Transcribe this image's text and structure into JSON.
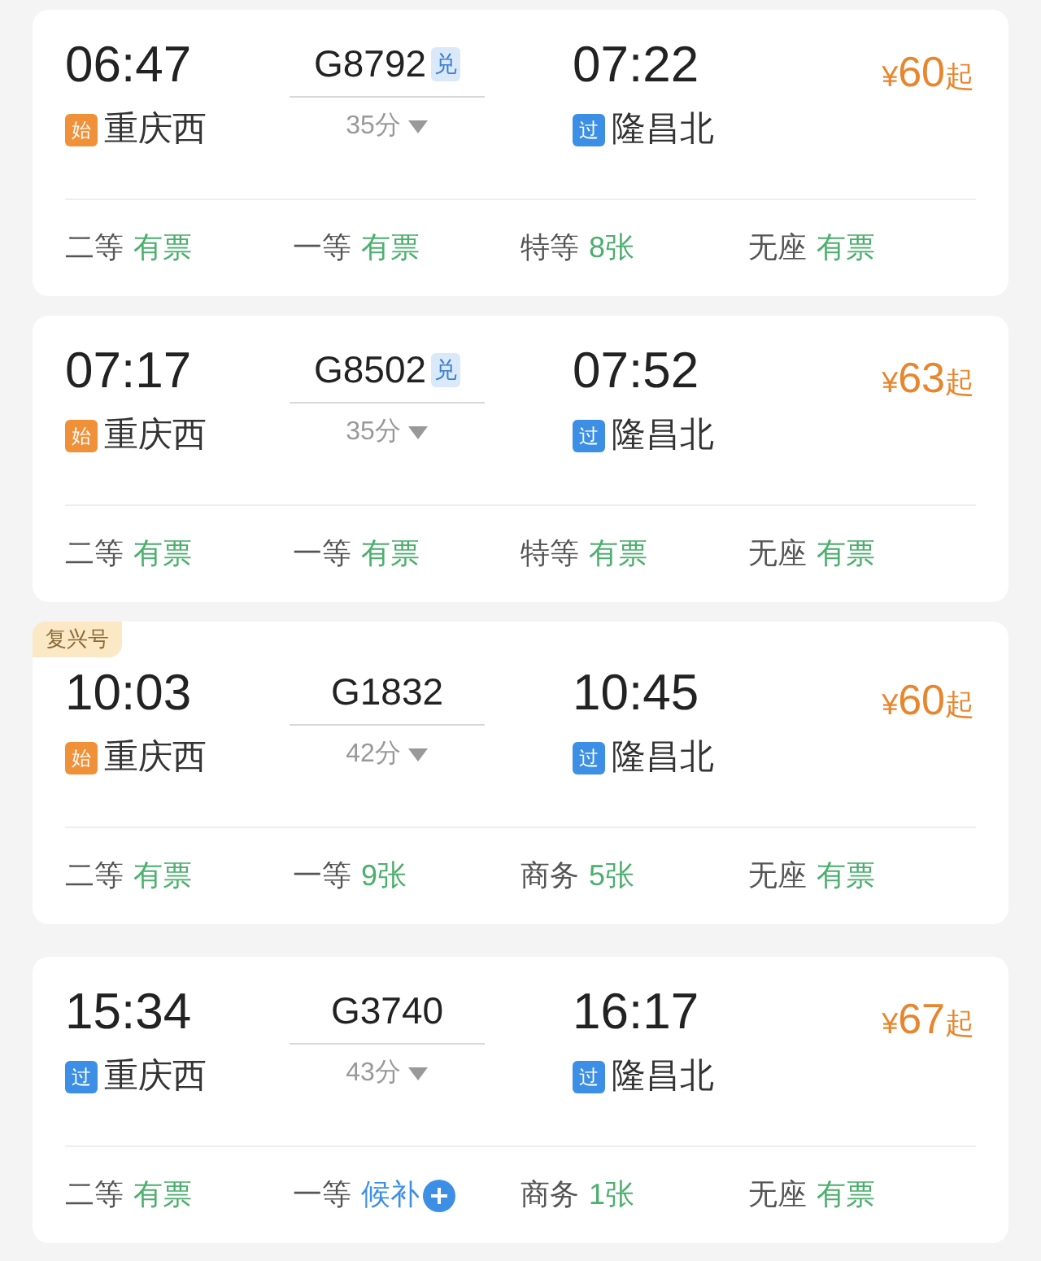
{
  "trains": [
    {
      "depart": "06:47",
      "train_no": "G8792",
      "exchange_badge": "兑",
      "arrive": "07:22",
      "from_tag": {
        "text": "始",
        "kind": "origin"
      },
      "from": "重庆西",
      "duration": "35分",
      "to_tag": {
        "text": "过",
        "kind": "pass"
      },
      "to": "隆昌北",
      "price": "¥60",
      "price_suffix": "起",
      "seats": [
        {
          "class": "二等",
          "status": "有票",
          "kind": "available"
        },
        {
          "class": "一等",
          "status": "有票",
          "kind": "available"
        },
        {
          "class": "特等",
          "status": "8张",
          "kind": "available"
        },
        {
          "class": "无座",
          "status": "有票",
          "kind": "available"
        }
      ]
    },
    {
      "depart": "07:17",
      "train_no": "G8502",
      "exchange_badge": "兑",
      "arrive": "07:52",
      "from_tag": {
        "text": "始",
        "kind": "origin"
      },
      "from": "重庆西",
      "duration": "35分",
      "to_tag": {
        "text": "过",
        "kind": "pass"
      },
      "to": "隆昌北",
      "price": "¥63",
      "price_suffix": "起",
      "seats": [
        {
          "class": "二等",
          "status": "有票",
          "kind": "available"
        },
        {
          "class": "一等",
          "status": "有票",
          "kind": "available"
        },
        {
          "class": "特等",
          "status": "有票",
          "kind": "available"
        },
        {
          "class": "无座",
          "status": "有票",
          "kind": "available"
        }
      ]
    },
    {
      "tag": "复兴号",
      "depart": "10:03",
      "train_no": "G1832",
      "arrive": "10:45",
      "from_tag": {
        "text": "始",
        "kind": "origin"
      },
      "from": "重庆西",
      "duration": "42分",
      "to_tag": {
        "text": "过",
        "kind": "pass"
      },
      "to": "隆昌北",
      "price": "¥60",
      "price_suffix": "起",
      "seats": [
        {
          "class": "二等",
          "status": "有票",
          "kind": "available"
        },
        {
          "class": "一等",
          "status": "9张",
          "kind": "available"
        },
        {
          "class": "商务",
          "status": "5张",
          "kind": "available"
        },
        {
          "class": "无座",
          "status": "有票",
          "kind": "available"
        }
      ]
    },
    {
      "depart": "15:34",
      "train_no": "G3740",
      "arrive": "16:17",
      "from_tag": {
        "text": "过",
        "kind": "pass"
      },
      "from": "重庆西",
      "duration": "43分",
      "to_tag": {
        "text": "过",
        "kind": "pass"
      },
      "to": "隆昌北",
      "price": "¥67",
      "price_suffix": "起",
      "seats": [
        {
          "class": "二等",
          "status": "有票",
          "kind": "available"
        },
        {
          "class": "一等",
          "status": "候补",
          "kind": "waitlist"
        },
        {
          "class": "商务",
          "status": "1张",
          "kind": "available"
        },
        {
          "class": "无座",
          "status": "有票",
          "kind": "available"
        }
      ]
    }
  ]
}
